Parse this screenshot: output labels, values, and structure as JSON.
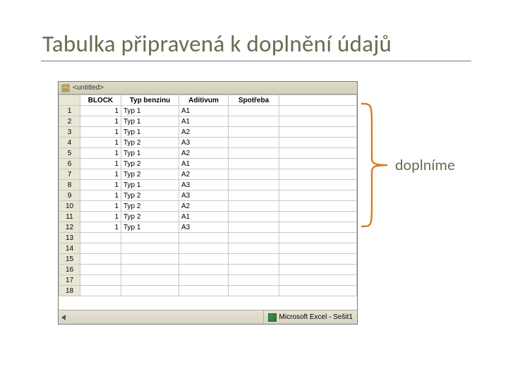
{
  "title": "Tabulka připravená k doplnění údajů",
  "sheet": {
    "window_title": "<untitled>",
    "columns": [
      "BLOCK",
      "Typ benzinu",
      "Aditivum",
      "Spotřeba"
    ],
    "rows": [
      {
        "n": "1",
        "block": "1",
        "typ": "Typ 1",
        "adit": "A1",
        "spot": ""
      },
      {
        "n": "2",
        "block": "1",
        "typ": "Typ 1",
        "adit": "A1",
        "spot": ""
      },
      {
        "n": "3",
        "block": "1",
        "typ": "Typ 1",
        "adit": "A2",
        "spot": ""
      },
      {
        "n": "4",
        "block": "1",
        "typ": "Typ 2",
        "adit": "A3",
        "spot": ""
      },
      {
        "n": "5",
        "block": "1",
        "typ": "Typ 1",
        "adit": "A2",
        "spot": ""
      },
      {
        "n": "6",
        "block": "1",
        "typ": "Typ 2",
        "adit": "A1",
        "spot": ""
      },
      {
        "n": "7",
        "block": "1",
        "typ": "Typ 2",
        "adit": "A2",
        "spot": ""
      },
      {
        "n": "8",
        "block": "1",
        "typ": "Typ 1",
        "adit": "A3",
        "spot": ""
      },
      {
        "n": "9",
        "block": "1",
        "typ": "Typ 2",
        "adit": "A3",
        "spot": ""
      },
      {
        "n": "10",
        "block": "1",
        "typ": "Typ 2",
        "adit": "A2",
        "spot": ""
      },
      {
        "n": "11",
        "block": "1",
        "typ": "Typ 2",
        "adit": "A1",
        "spot": ""
      },
      {
        "n": "12",
        "block": "1",
        "typ": "Typ 1",
        "adit": "A3",
        "spot": ""
      },
      {
        "n": "13",
        "block": "",
        "typ": "",
        "adit": "",
        "spot": ""
      },
      {
        "n": "14",
        "block": "",
        "typ": "",
        "adit": "",
        "spot": ""
      },
      {
        "n": "15",
        "block": "",
        "typ": "",
        "adit": "",
        "spot": ""
      },
      {
        "n": "16",
        "block": "",
        "typ": "",
        "adit": "",
        "spot": ""
      },
      {
        "n": "17",
        "block": "",
        "typ": "",
        "adit": "",
        "spot": ""
      },
      {
        "n": "18",
        "block": "",
        "typ": "",
        "adit": "",
        "spot": ""
      }
    ],
    "statusbar_label": "Microsoft Excel - Sešit1"
  },
  "annotation": {
    "text": "doplníme",
    "brace_color": "#d97a1f"
  }
}
